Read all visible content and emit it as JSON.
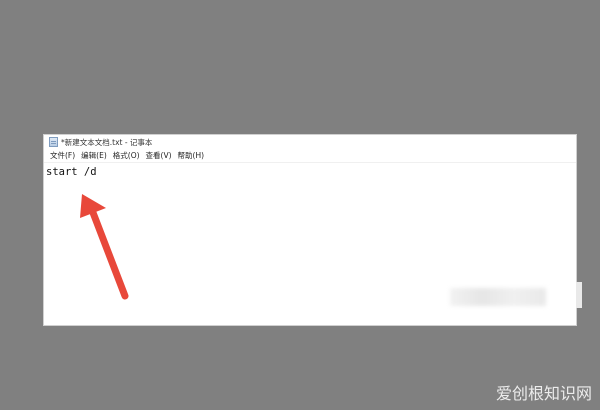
{
  "window": {
    "title": "*新建文本文档.txt - 记事本"
  },
  "menu": [
    {
      "label": "文件(F)"
    },
    {
      "label": "编辑(E)"
    },
    {
      "label": "格式(O)"
    },
    {
      "label": "查看(V)"
    },
    {
      "label": "帮助(H)"
    }
  ],
  "editor": {
    "content": "start /d"
  },
  "annotation": {
    "arrow_color": "#e8483a"
  },
  "watermark": {
    "text": "爱创根知识网"
  },
  "colors": {
    "background": "#808080",
    "window": "#ffffff"
  }
}
